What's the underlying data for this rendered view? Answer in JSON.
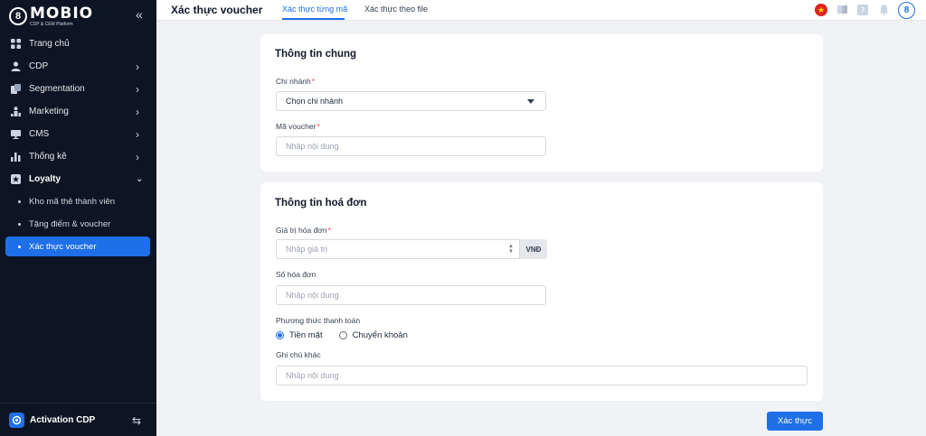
{
  "brand": {
    "logo_glyph": "8",
    "name": "MOBIO",
    "subtitle": "CDP & CEM Platform"
  },
  "sidebar": {
    "collapse_icon": "«",
    "items": [
      {
        "label": "Trang chủ",
        "icon": "grid-icon"
      },
      {
        "label": "CDP",
        "icon": "user-icon"
      },
      {
        "label": "Segmentation",
        "icon": "segment-icon"
      },
      {
        "label": "Marketing",
        "icon": "marketing-icon"
      },
      {
        "label": "CMS",
        "icon": "monitor-icon"
      },
      {
        "label": "Thống kê",
        "icon": "chart-icon"
      },
      {
        "label": "Loyalty",
        "icon": "star-icon"
      }
    ],
    "loyalty_sub": [
      {
        "label": "Kho mã thẻ thành viên"
      },
      {
        "label": "Tặng điểm & voucher"
      },
      {
        "label": "Xác thực voucher"
      }
    ],
    "bottom": {
      "label": "Activation CDP"
    }
  },
  "header": {
    "title": "Xác thực voucher",
    "tabs": [
      {
        "label": "Xác thực từng mã"
      },
      {
        "label": "Xác thực theo file"
      }
    ]
  },
  "general": {
    "title": "Thông tin chung",
    "branch_label": "Chi nhánh",
    "branch_value": "Chọn chi nhánh",
    "voucher_label": "Mã voucher",
    "voucher_placeholder": "Nhập nội dung"
  },
  "invoice": {
    "title": "Thông tin hoá đơn",
    "value_label": "Giá trị hóa đơn",
    "value_placeholder": "Nhập giá trị",
    "currency": "VNĐ",
    "number_label": "Số hóa đơn",
    "number_placeholder": "Nhập nội dung",
    "payment_label": "Phương thức thanh toán",
    "payment_options": [
      {
        "label": "Tiền mặt",
        "checked": true
      },
      {
        "label": "Chuyển khoản",
        "checked": false
      }
    ],
    "note_label": "Ghi chú khác",
    "note_placeholder": "Nhập nội dung"
  },
  "actions": {
    "submit": "Xác thực"
  },
  "colors": {
    "accent": "#1e6fe8",
    "sidebar_bg": "#0d1524",
    "required": "#ef4444"
  }
}
